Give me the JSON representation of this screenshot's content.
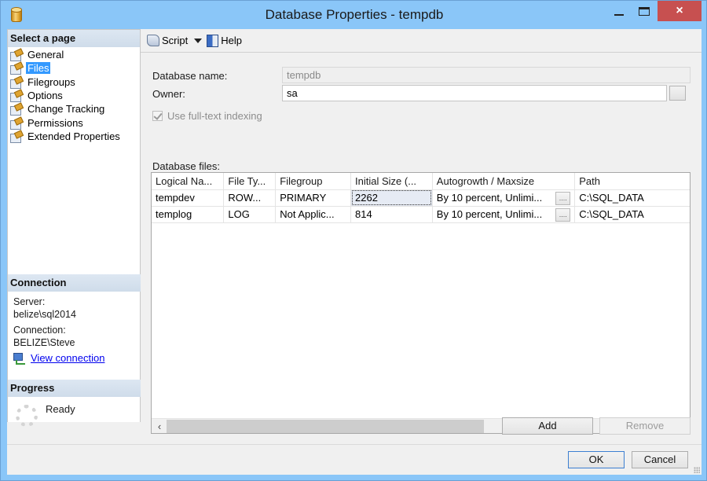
{
  "window": {
    "title": "Database Properties - tempdb",
    "controls": {
      "minimize": "minimize",
      "maximize": "maximize",
      "close": "×"
    }
  },
  "sidebar": {
    "select_page_header": "Select a page",
    "pages": [
      {
        "label": "General",
        "icon": "page-settings-icon",
        "selected": false
      },
      {
        "label": "Files",
        "icon": "page-settings-icon",
        "selected": true
      },
      {
        "label": "Filegroups",
        "icon": "page-settings-icon",
        "selected": false
      },
      {
        "label": "Options",
        "icon": "page-settings-icon",
        "selected": false
      },
      {
        "label": "Change Tracking",
        "icon": "page-settings-icon",
        "selected": false
      },
      {
        "label": "Permissions",
        "icon": "page-settings-icon",
        "selected": false
      },
      {
        "label": "Extended Properties",
        "icon": "page-settings-icon",
        "selected": false
      }
    ],
    "connection": {
      "header": "Connection",
      "server_label": "Server:",
      "server_value": "belize\\sql2014",
      "connection_label": "Connection:",
      "connection_value": "BELIZE\\Steve",
      "view_connection_link": "View connection"
    },
    "progress": {
      "header": "Progress",
      "status": "Ready"
    }
  },
  "toolbar": {
    "script_label": "Script",
    "help_label": "Help"
  },
  "form": {
    "database_name_label": "Database name:",
    "database_name_value": "tempdb",
    "owner_label": "Owner:",
    "owner_value": "sa",
    "fulltext_label": "Use full-text indexing",
    "fulltext_checked": true,
    "database_files_label": "Database files:"
  },
  "files_grid": {
    "columns": [
      "Logical Na...",
      "File Ty...",
      "Filegroup",
      "Initial Size (...",
      "Autogrowth / Maxsize",
      "Path"
    ],
    "rows": [
      {
        "logical_name": "tempdev",
        "file_type": "ROW...",
        "filegroup": "PRIMARY",
        "initial_size": "2262",
        "autogrowth": "By 10 percent, Unlimi...",
        "path": "C:\\SQL_DATA"
      },
      {
        "logical_name": "templog",
        "file_type": "LOG",
        "filegroup": "Not Applic...",
        "initial_size": "814",
        "autogrowth": "By 10 percent, Unlimi...",
        "path": "C:\\SQL_DATA"
      }
    ],
    "ellipsis_label": "...."
  },
  "buttons": {
    "add": "Add",
    "remove": "Remove",
    "ok": "OK",
    "cancel": "Cancel"
  },
  "colors": {
    "titlebar": "#8ac6f8",
    "close_button": "#c75050",
    "selection": "#3399ff",
    "link": "#0000ee"
  }
}
